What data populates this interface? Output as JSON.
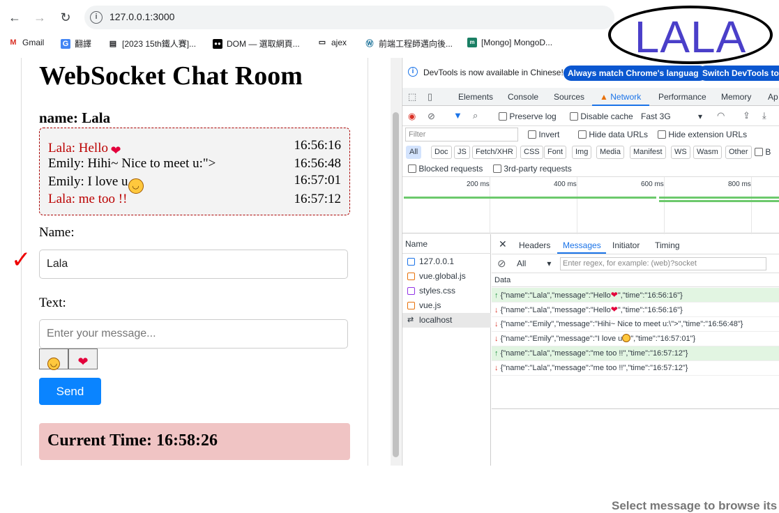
{
  "browser": {
    "url": "127.0.0.1:3000",
    "bookmarks": [
      "Gmail",
      "翻譯",
      "[2023 15th鐵人賽]...",
      "DOM — 選取網頁...",
      "ajex",
      "前端工程師邁向後...",
      "[Mongo] MongoD..."
    ]
  },
  "annotation": {
    "logo_text": "LALA"
  },
  "app": {
    "title": "WebSocket Chat Room",
    "name_header": "name: Lala",
    "messages": [
      {
        "text": "Lala: Hello",
        "emoji": "heart",
        "time": "16:56:16",
        "color": "#bb0000"
      },
      {
        "text": "Emily: Hihi~ Nice to meet u:\">",
        "emoji": "",
        "time": "16:56:48",
        "color": "#000000"
      },
      {
        "text": "Emily: I love u",
        "emoji": "smile",
        "time": "16:57:01",
        "color": "#000000"
      },
      {
        "text": "Lala: me too !!",
        "emoji": "",
        "time": "16:57:12",
        "color": "#bb0000"
      }
    ],
    "name_label": "Name:",
    "name_value": "Lala",
    "text_label": "Text:",
    "text_placeholder": "Enter your message...",
    "emoji_buttons": [
      "smile",
      "heart"
    ],
    "send_label": "Send",
    "current_time": "Current Time: 16:58:26"
  },
  "devtools": {
    "info": "DevTools is now available in Chinese!",
    "btn_match": "Always match Chrome's language",
    "btn_switch": "Switch DevTools to C",
    "tabs": [
      "Elements",
      "Console",
      "Sources",
      "Network",
      "Performance",
      "Memory",
      "Ap"
    ],
    "active_tab": "Network",
    "preserve_log": "Preserve log",
    "disable_cache": "Disable cache",
    "throttle": "Fast 3G",
    "filter_placeholder": "Filter",
    "invert": "Invert",
    "hide_data_urls": "Hide data URLs",
    "hide_ext_urls": "Hide extension URLs",
    "chips": [
      "All",
      "Doc",
      "JS",
      "Fetch/XHR",
      "CSS",
      "Font",
      "Img",
      "Media",
      "Manifest",
      "WS",
      "Wasm",
      "Other",
      "B"
    ],
    "blocked": "Blocked requests",
    "third_party": "3rd-party requests",
    "timeline_labels": [
      "200 ms",
      "400 ms",
      "600 ms",
      "800 ms"
    ],
    "name_header": "Name",
    "files": [
      "127.0.0.1",
      "vue.global.js",
      "styles.css",
      "vue.js",
      "localhost"
    ],
    "detail_tabs": [
      "Headers",
      "Messages",
      "Initiator",
      "Timing"
    ],
    "msg_filter": "All",
    "regex_placeholder": "Enter regex, for example: (web)?socket",
    "data_header": "Data",
    "frames": [
      {
        "dir": "sent",
        "pre": "{\"name\":\"Lala\",\"message\":\"Hello",
        "icon": "heart",
        "post": "\",\"time\":\"16:56:16\"}"
      },
      {
        "dir": "recv",
        "pre": "{\"name\":\"Lala\",\"message\":\"Hello",
        "icon": "heart",
        "post": "\",\"time\":\"16:56:16\"}"
      },
      {
        "dir": "recv",
        "pre": "{\"name\":\"Emily\",\"message\":\"Hihi~ Nice to meet u:\\\">\",\"time\":\"16:56:48\"}",
        "icon": "",
        "post": ""
      },
      {
        "dir": "recv",
        "pre": "{\"name\":\"Emily\",\"message\":\"I love u",
        "icon": "smile",
        "post": "\",\"time\":\"16:57:01\"}"
      },
      {
        "dir": "sent",
        "pre": "{\"name\":\"Lala\",\"message\":\"me too !!\",\"time\":\"16:57:12\"}",
        "icon": "",
        "post": ""
      },
      {
        "dir": "recv",
        "pre": "{\"name\":\"Lala\",\"message\":\"me too !!\",\"time\":\"16:57:12\"}",
        "icon": "",
        "post": ""
      }
    ],
    "select_hint": "Select message to browse its"
  }
}
